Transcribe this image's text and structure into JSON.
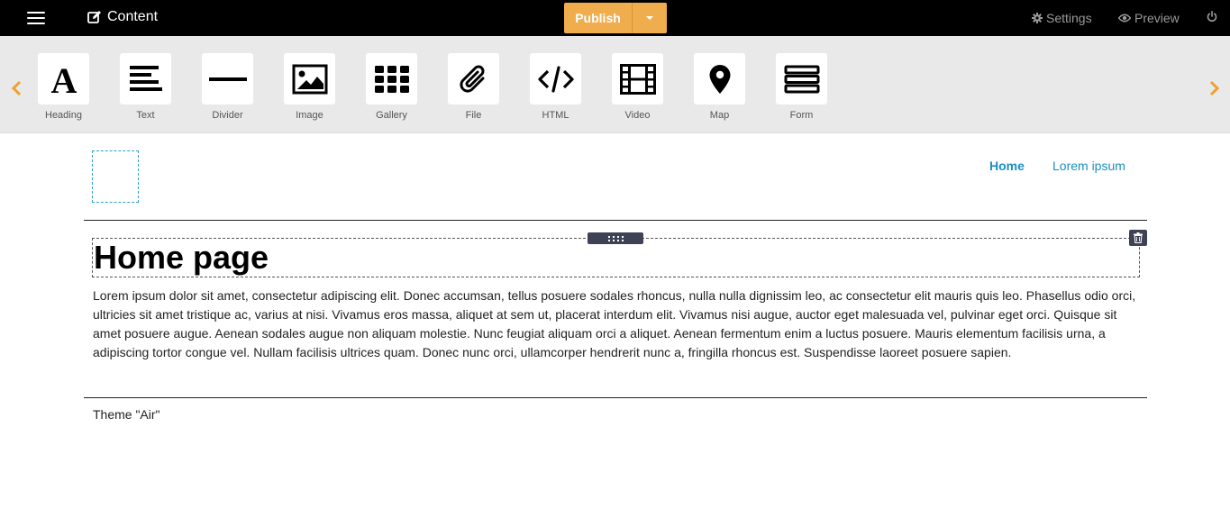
{
  "topbar": {
    "title": "Content",
    "publish_label": "Publish",
    "settings_label": "Settings",
    "preview_label": "Preview",
    "accent_color": "#f0ad4e"
  },
  "toolbar": {
    "tools": [
      {
        "label": "Heading",
        "icon": "heading-icon"
      },
      {
        "label": "Text",
        "icon": "text-lines-icon"
      },
      {
        "label": "Divider",
        "icon": "divider-icon"
      },
      {
        "label": "Image",
        "icon": "image-icon"
      },
      {
        "label": "Gallery",
        "icon": "grid-icon"
      },
      {
        "label": "File",
        "icon": "paperclip-icon"
      },
      {
        "label": "HTML",
        "icon": "code-icon"
      },
      {
        "label": "Video",
        "icon": "film-icon"
      },
      {
        "label": "Map",
        "icon": "map-pin-icon"
      },
      {
        "label": "Form",
        "icon": "form-icon"
      }
    ]
  },
  "page": {
    "nav": [
      "Home",
      "Lorem ipsum"
    ],
    "heading": "Home page",
    "paragraph": "Lorem ipsum dolor sit amet, consectetur adipiscing elit. Donec accumsan, tellus posuere sodales rhoncus, nulla nulla dignissim leo, ac consectetur elit mauris quis leo. Phasellus odio orci, ultricies sit amet tristique ac, varius at nisi. Vivamus eros massa, aliquet at sem ut, placerat interdum elit. Vivamus nisi augue, auctor eget malesuada vel, pulvinar eget orci. Quisque sit amet posuere augue. Aenean sodales augue non aliquam molestie. Nunc feugiat aliquam orci a aliquet. Aenean fermentum enim a luctus posuere. Mauris elementum facilisis urna, a adipiscing tortor congue vel. Nullam facilisis ultrices quam. Donec nunc orci, ullamcorper hendrerit nunc a, fringilla rhoncus est. Suspendisse laoreet posuere sapien.",
    "footer": "Theme \"Air\"",
    "link_color": "#1a8fc2"
  }
}
